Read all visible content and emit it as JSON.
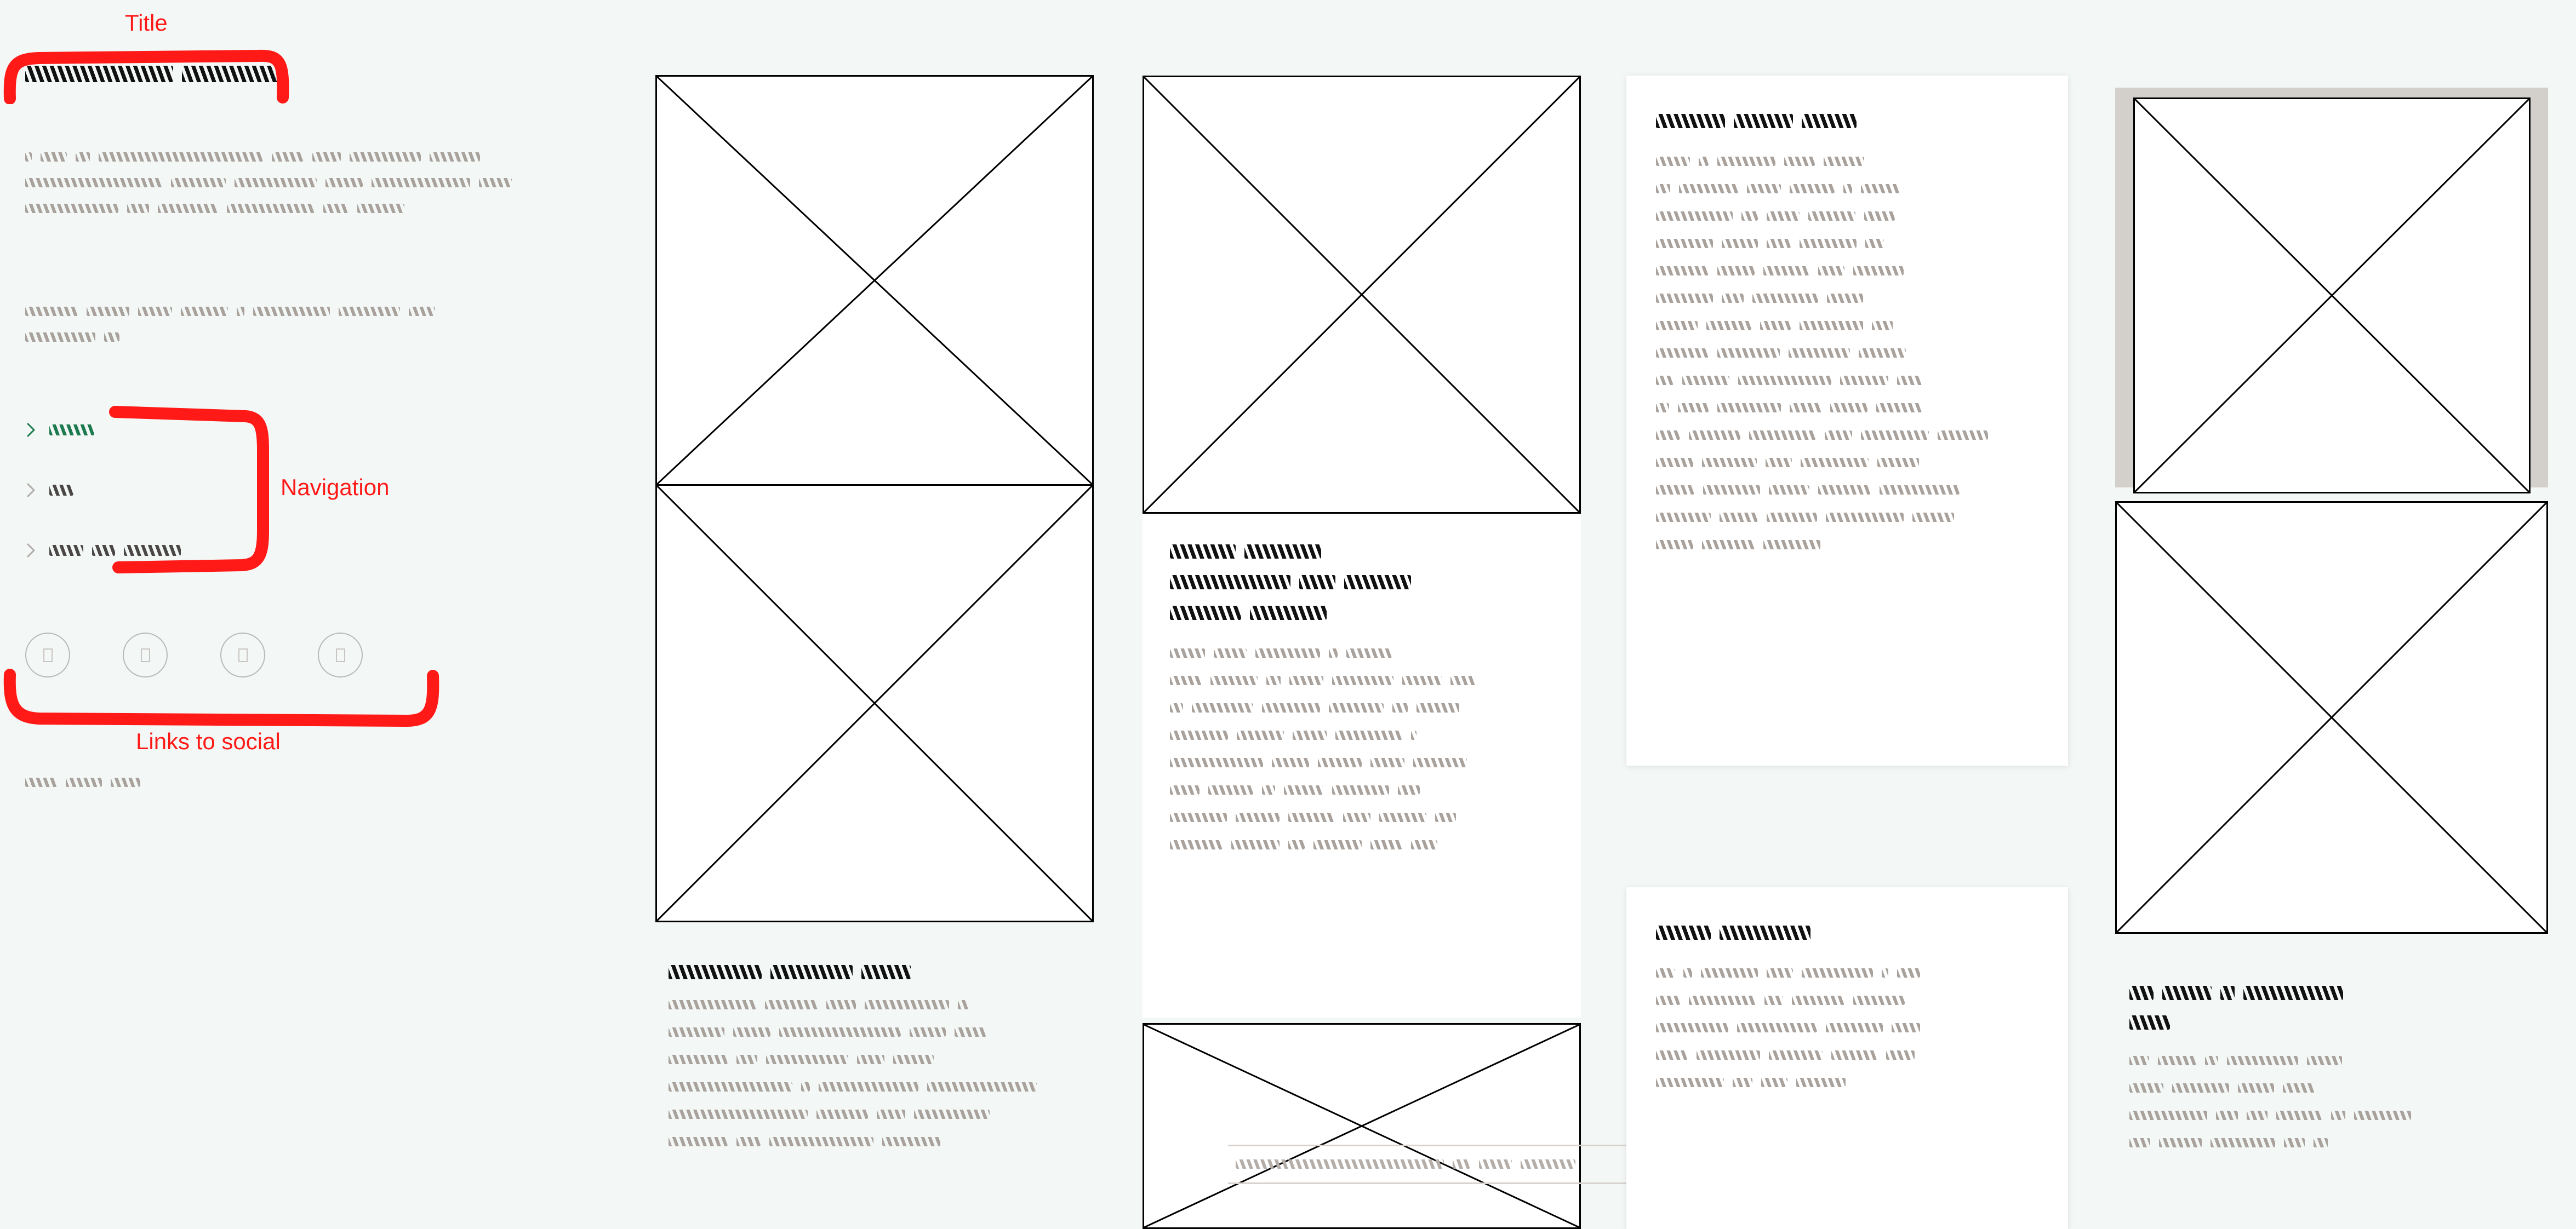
{
  "page": {
    "background_color": "#f3f7f5",
    "annotation_color": "#ff1a18",
    "heading_color": "#111111",
    "body_text_color": "#a9a29c",
    "nav_active_color": "#1c7a4f",
    "placeholder_border_color": "#000000",
    "matte_color": "#d3cfca"
  },
  "annotations": [
    {
      "id": "title",
      "label": "Title"
    },
    {
      "id": "navigation",
      "label": "Navigation"
    },
    {
      "id": "social",
      "label": "Links to social"
    }
  ],
  "sidebar": {
    "site_title": {
      "style": "redacted-scribble",
      "color": "#111111",
      "words": [
        270,
        190
      ]
    },
    "intro_paragraph_1": {
      "style": "redacted-scribble",
      "color": "#a9a29c",
      "lines": [
        [
          12,
          48,
          26,
          300,
          58,
          52
        ],
        [
          250,
          100,
          150,
          68,
          60
        ],
        [
          170,
          110,
          80,
          86,
          72
        ]
      ]
    },
    "intro_paragraph_2": {
      "style": "redacted-scribble",
      "color": "#a9a29c",
      "lines": [
        [
          96,
          78,
          62,
          86,
          18,
          140,
          112,
          48
        ],
        [
          128,
          28
        ]
      ]
    },
    "navigation": {
      "items": [
        {
          "style": "redacted-scribble",
          "state": "active",
          "color": "#1c7a4f",
          "width": 82,
          "icon": "chevron-right-icon"
        },
        {
          "style": "redacted-scribble",
          "state": "inactive",
          "color": "#4a4745",
          "width": 44,
          "icon": "chevron-right-icon"
        },
        {
          "style": "redacted-scribble",
          "state": "inactive",
          "color": "#4a4745",
          "width": 0,
          "icon": "chevron-right-icon",
          "words": [
            62,
            42,
            104
          ]
        }
      ]
    },
    "social_links": {
      "count": 4,
      "glyph": "missing-glyph-box",
      "icons": [
        "social-icon-1",
        "social-icon-2",
        "social-icon-3",
        "social-icon-4"
      ]
    },
    "copyright": {
      "style": "redacted-scribble",
      "color": "#a9a29c",
      "words": [
        58,
        66,
        54
      ]
    }
  },
  "columns": [
    {
      "id": "column-1",
      "blocks": [
        {
          "type": "image-placeholder",
          "name": "image-placeholder-1"
        },
        {
          "type": "image-placeholder",
          "name": "image-placeholder-2"
        },
        {
          "type": "text",
          "heading": {
            "style": "redacted-scribble",
            "color": "#111111",
            "words": [
              170,
              150,
              90
            ]
          },
          "body": {
            "style": "redacted-scribble",
            "color": "#a9a29c",
            "lines": [
              [
                160,
                96,
                54,
                154,
                20
              ],
              [
                102,
                68,
                222,
                66,
                58
              ],
              [
                108,
                38,
                150,
                50,
                74
              ],
              [
                226,
                16,
                182,
                200
              ],
              [
                254,
                94,
                52,
                138
              ],
              [
                108,
                44,
                190,
                106
              ]
            ]
          }
        }
      ]
    },
    {
      "id": "column-2",
      "blocks": [
        {
          "type": "image-placeholder",
          "name": "image-placeholder-3"
        },
        {
          "type": "text-card",
          "heading": {
            "style": "redacted-scribble",
            "color": "#111111",
            "lines": [
              [
                120,
                140
              ],
              [
                220,
                66,
                122
              ],
              [
                130,
                140
              ]
            ]
          },
          "body": {
            "style": "redacted-scribble",
            "color": "#a9a29c",
            "lines": [
              [
                64,
                60,
                118,
                16,
                84
              ],
              [
                58,
                86,
                26,
                62,
                112,
                72,
                46
              ],
              [
                24,
                112,
                106,
                100,
                28,
                78
              ],
              [
                106,
                86,
                62,
                122,
                10
              ],
              [
                170,
                68,
                80,
                62,
                98
              ],
              [
                54,
                82,
                24,
                72,
                104,
                40
              ],
              [
                104,
                80,
                84,
                50,
                86,
                38
              ],
              [
                96,
                88,
                30,
                88,
                58,
                48
              ]
            ]
          }
        },
        {
          "type": "image-placeholder-with-caption",
          "name": "image-placeholder-4",
          "caption": {
            "style": "redacted-scribble",
            "color": "#a9a29c",
            "words": [
              380,
              32,
              60,
              100
            ]
          }
        }
      ]
    },
    {
      "id": "column-3",
      "blocks": [
        {
          "type": "text-card",
          "name": "article-card-1",
          "heading": {
            "style": "redacted-scribble",
            "color": "#111111",
            "words": [
              126,
              108,
              100
            ]
          },
          "body": {
            "style": "redacted-scribble",
            "color": "#a9a29c",
            "lines": [
              [
                62,
                18,
                106,
                56,
                74
              ],
              [
                26,
                108,
                62,
                82,
                16,
                70
              ],
              [
                140,
                30,
                60,
                86,
                56
              ],
              [
                104,
                66,
                44,
                104,
                34
              ],
              [
                96,
                68,
                84,
                48,
                92
              ],
              [
                104,
                40,
                120,
                66
              ],
              [
                76,
                82,
                56,
                116,
                38
              ],
              [
                96,
                114,
                112,
                86
              ],
              [
                32,
                86,
                170,
                88,
                46
              ],
              [
                24,
                56,
                116,
                58,
                68,
                84
              ],
              [
                44,
                94,
                122,
                50,
                124,
                92
              ],
              [
                68,
                100,
                48,
                124,
                76
              ],
              [
                70,
                104,
                74,
                96,
                146
              ],
              [
                100,
                70,
                92,
                142,
                76
              ],
              [
                68,
                96,
                104
              ]
            ]
          }
        },
        {
          "type": "text-card",
          "name": "article-card-2",
          "heading": {
            "style": "redacted-scribble",
            "color": "#111111",
            "words": [
              100,
              166
            ]
          },
          "body": {
            "style": "redacted-scribble",
            "color": "#a9a29c",
            "lines": [
              [
                34,
                16,
                104,
                48,
                130,
                12,
                42
              ],
              [
                44,
                122,
                34,
                96,
                94
              ],
              [
                132,
                146,
                104,
                52
              ],
              [
                58,
                116,
                98,
                84,
                52
              ],
              [
                124,
                36,
                48,
                90
              ]
            ]
          }
        }
      ]
    },
    {
      "id": "column-4",
      "blocks": [
        {
          "type": "image-placeholder-matte",
          "name": "image-placeholder-5"
        },
        {
          "type": "image-placeholder",
          "name": "image-placeholder-6"
        },
        {
          "type": "text",
          "heading": {
            "style": "redacted-scribble",
            "color": "#111111",
            "lines": [
              [
                44,
                90,
                26,
                182
              ],
              [
                74
              ]
            ]
          },
          "body": {
            "style": "redacted-scribble",
            "color": "#a9a29c",
            "lines": [
              [
                36,
                70,
                24,
                130,
                64
              ],
              [
                62,
                104,
                66,
                58
              ],
              [
                142,
                40,
                38,
                84,
                26,
                104
              ],
              [
                38,
                78,
                118,
                38,
                26
              ]
            ]
          }
        }
      ]
    }
  ]
}
